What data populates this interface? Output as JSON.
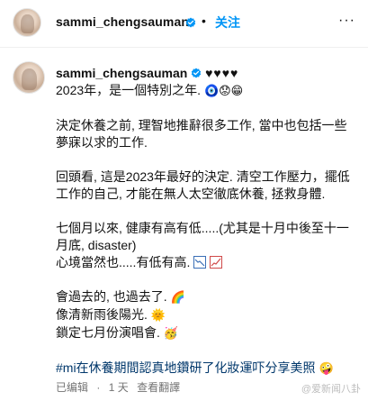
{
  "header": {
    "username": "sammi_chengsauman",
    "separator": "•",
    "follow_label": "关注",
    "more_label": "···"
  },
  "caption": {
    "username": "sammi_chengsauman",
    "hearts": "♥♥♥♥",
    "lines": {
      "l1": "2023年，是一個特別之年.",
      "l1_emoji": "🧿😟😁",
      "p2a": "決定休養之前, 理智地推辭很多工作, 當中也包括一些",
      "p2b": "夢寐以求的工作.",
      "p3a": "回頭看, 這是2023年最好的決定. 清空工作壓力，擺低",
      "p3b": "工作的自己, 才能在無人太空徹底休養, 拯救身體.",
      "p4a": "七個月以來, 健康有高有低.....(尤其是十月中後至十一",
      "p4b": "月底, disaster)",
      "p4c": "心境當然也.....有低有高.",
      "p5a": "會過去的, 也過去了.",
      "p5a_emoji": "🌈",
      "p5b": "像清新雨後陽光.",
      "p5b_emoji": "🌞",
      "p5c": "鎖定七月份演唱會.",
      "p5c_emoji": "🥳",
      "hashtag": "#mi在休養期間認真地鑽研了化妝運吓分享美照",
      "hashtag_emoji": "🤪"
    }
  },
  "meta": {
    "edited": "已编辑",
    "dot": "·",
    "age": "1 天",
    "translate": "查看翻譯"
  },
  "watermark": "@爱新闻八卦",
  "colors": {
    "follow": "#0095f6",
    "verified": "#0095f6",
    "hashtag": "#00376b",
    "meta": "#737373"
  }
}
